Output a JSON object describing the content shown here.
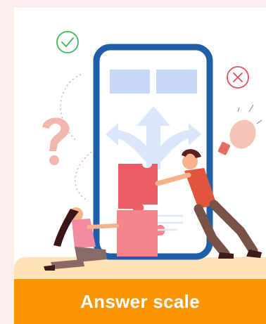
{
  "card": {
    "title": "Answer scale"
  },
  "icons": {
    "check": "check-circle-icon",
    "close": "close-circle-icon",
    "question": "question-mark-icon",
    "bulb": "lightbulb-icon",
    "puzzle": "puzzle-icon",
    "arrows": "split-arrows-icon"
  },
  "colors": {
    "background": "#fbeeed",
    "accent": "#fa9500",
    "phone_frame": "#1e5fa8",
    "check": "#3dba5a",
    "close": "#e0505e"
  }
}
